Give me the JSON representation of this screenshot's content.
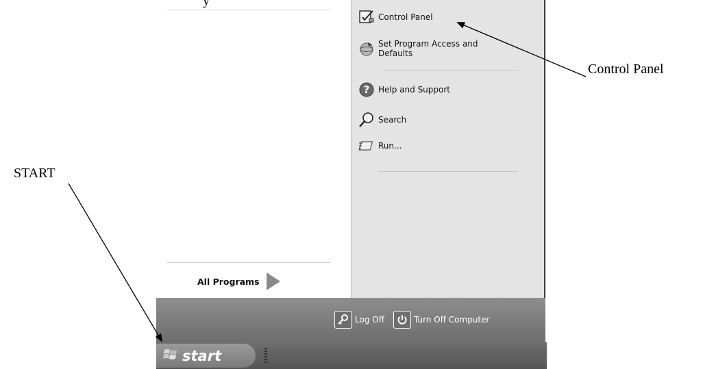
{
  "menu": {
    "right_items": [
      {
        "label": "Control Panel",
        "icon": "control-panel-icon"
      },
      {
        "label": "Set Program Access and Defaults",
        "icon": "program-access-icon"
      },
      {
        "label": "Help and Support",
        "icon": "help-icon"
      },
      {
        "label": "Search",
        "icon": "search-icon"
      },
      {
        "label": "Run...",
        "icon": "run-icon"
      }
    ],
    "set_program_line1": "Set Program Access and",
    "set_program_line2": "Defaults",
    "all_programs": "All Programs"
  },
  "bottom": {
    "log_off": "Log Off",
    "turn_off": "Turn Off Computer"
  },
  "taskbar": {
    "start_label": "start"
  },
  "annotations": {
    "control_panel": "Control Panel",
    "start": "START",
    "top_fragment": "y"
  },
  "colors": {
    "right_pane": "#e4e4e4",
    "bottom_bar": "#7d7d7d",
    "taskbar": "#5f5f5f"
  }
}
